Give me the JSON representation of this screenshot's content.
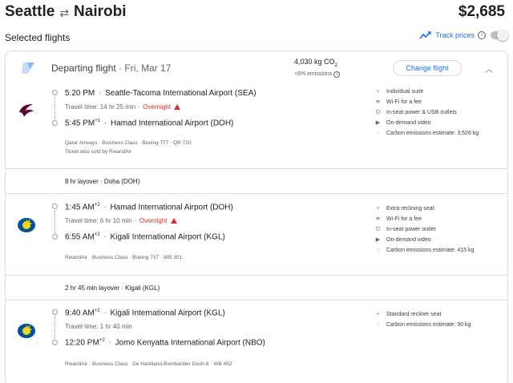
{
  "header": {
    "origin": "Seattle",
    "destination": "Nairobi",
    "price": "$2,685"
  },
  "selected": {
    "title": "Selected flights",
    "track_prices_label": "Track prices"
  },
  "departing": {
    "label": "Departing flight",
    "date": "Fri, Mar 17",
    "co2": "4,030 kg CO",
    "co2_sub": "2",
    "emissions_note": "+6% emissions",
    "change_button": "Change flight"
  },
  "segments": [
    {
      "airline_icon": "qatar-airways-logo",
      "dep_time": "5:20 PM",
      "dep_sup": "",
      "dep_airport": "Seattle-Tacoma International Airport (SEA)",
      "travel": "Travel time: 14 hr 25 min",
      "overnight": "Overnight",
      "arr_time": "5:45 PM",
      "arr_sup": "+1",
      "arr_airport": "Hamad International Airport (DOH)",
      "meta1": "Qatar Airways · Business Class · Boeing 777 · QR 720",
      "meta2": "Ticket also sold by RwandAir",
      "amenities": [
        {
          "icon": "seat-icon",
          "text": "Individual suite"
        },
        {
          "icon": "wifi-icon",
          "text": "Wi-Fi for a fee"
        },
        {
          "icon": "power-icon",
          "text": "In-seat power & USB outlets"
        },
        {
          "icon": "video-icon",
          "text": "On-demand video"
        },
        {
          "icon": "co2-icon",
          "text": "Carbon emissions estimate: 3,526 kg"
        }
      ]
    },
    {
      "airline_icon": "rwandair-logo",
      "dep_time": "1:45 AM",
      "dep_sup": "+2",
      "dep_airport": "Hamad International Airport (DOH)",
      "travel": "Travel time: 6 hr 10 min",
      "overnight": "Overnight",
      "arr_time": "6:55 AM",
      "arr_sup": "+2",
      "arr_airport": "Kigali International Airport (KGL)",
      "meta1": "RwandAir · Business Class · Boeing 737 · WB 301",
      "meta2": "",
      "amenities": [
        {
          "icon": "recline-seat-icon",
          "text": "Extra reclining seat"
        },
        {
          "icon": "wifi-icon",
          "text": "Wi-Fi for a fee"
        },
        {
          "icon": "power-icon",
          "text": "In-seat power outlet"
        },
        {
          "icon": "video-icon",
          "text": "On-demand video"
        },
        {
          "icon": "co2-icon",
          "text": "Carbon emissions estimate: 415 kg"
        }
      ]
    },
    {
      "airline_icon": "rwandair-logo",
      "dep_time": "9:40 AM",
      "dep_sup": "+2",
      "dep_airport": "Kigali International Airport (KGL)",
      "travel": "Travel time: 1 hr 40 min",
      "overnight": "",
      "arr_time": "12:20 PM",
      "arr_sup": "+2",
      "arr_airport": "Jomo Kenyatta International Airport (NBO)",
      "meta1": "RwandAir · Business Class · De Havilland-Bombardier Dash-8 · WB 452",
      "meta2": "",
      "amenities": [
        {
          "icon": "recline-seat-icon",
          "text": "Standard recliner seat"
        },
        {
          "icon": "co2-icon",
          "text": "Carbon emissions estimate: 90 kg"
        }
      ]
    }
  ],
  "layovers": [
    "8 hr layover · Doha (DOH)",
    "2 hr 45 min layover · Kigali (KGL)"
  ],
  "colors": {
    "link": "#1a73e8",
    "warning": "#d93025",
    "border": "#dadce0"
  }
}
